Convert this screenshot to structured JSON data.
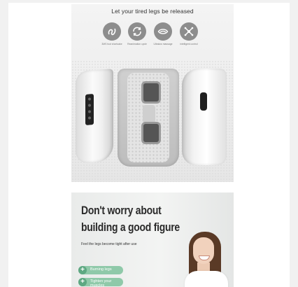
{
  "panel1": {
    "title": "Let your tired legs be released",
    "features": [
      {
        "icon": "wave-spiral-icon",
        "caption": "3MS foot shortcake"
      },
      {
        "icon": "circular-arrows-icon",
        "caption": "Reanimation cycle"
      },
      {
        "icon": "eye-massage-icon",
        "caption": "Ultralow massage"
      },
      {
        "icon": "crossed-arrows-icon",
        "caption": "intelligent control"
      }
    ]
  },
  "panel2": {
    "headline_line1": "Don't worry about",
    "headline_line2": "building a good figure",
    "subtext": "Feel the legs become tight after use",
    "bullets": [
      "Burning legs",
      "Tighten your muscles"
    ]
  },
  "colors": {
    "icon_grey": "#8d8d8d",
    "pill_green": "#8fc9a9",
    "plus_green": "#5ea882"
  }
}
